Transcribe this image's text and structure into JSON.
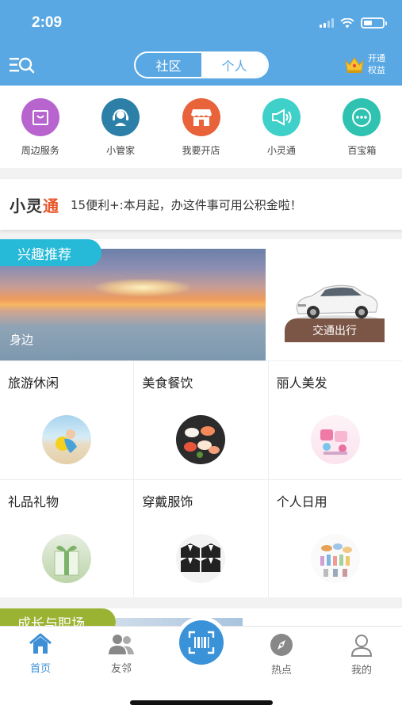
{
  "status_bar": {
    "time": "2:09"
  },
  "header": {
    "tabs": [
      {
        "label": "社区",
        "active": false
      },
      {
        "label": "个人",
        "active": true
      }
    ],
    "vip": {
      "line1": "开通",
      "line2": "权益"
    },
    "colors": {
      "primary": "#5aa8e3"
    }
  },
  "services": [
    {
      "label": "周边服务",
      "icon": "shopping-bag-icon",
      "color": "#b764cf"
    },
    {
      "label": "小管家",
      "icon": "headset-icon",
      "color": "#2c80a8"
    },
    {
      "label": "我要开店",
      "icon": "store-icon",
      "color": "#e8623a"
    },
    {
      "label": "小灵通",
      "icon": "megaphone-icon",
      "color": "#3fd0c9"
    },
    {
      "label": "百宝箱",
      "icon": "more-dots-icon",
      "color": "#2fc2b0"
    }
  ],
  "news": {
    "logo_a": "小灵",
    "logo_b": "通",
    "text": "15便利+:本月起，办这件事可用公积金啦！"
  },
  "interest": {
    "badge": "兴趣推荐",
    "banner_label": "身边",
    "traffic_label": "交通出行",
    "categories": [
      {
        "label": "旅游休闲",
        "icon": "beach-photo"
      },
      {
        "label": "美食餐饮",
        "icon": "sushi-photo"
      },
      {
        "label": "丽人美发",
        "icon": "beauty-photo"
      },
      {
        "label": "礼品礼物",
        "icon": "gift-photo"
      },
      {
        "label": "穿戴服饰",
        "icon": "suits-photo"
      },
      {
        "label": "个人日用",
        "icon": "daily-goods-photo"
      }
    ]
  },
  "growth": {
    "badge": "成长与职场"
  },
  "tabbar": {
    "items": [
      {
        "label": "首页",
        "icon": "home-icon",
        "active": true
      },
      {
        "label": "友邻",
        "icon": "neighbors-icon",
        "active": false
      },
      {
        "label": "热点",
        "icon": "compass-icon",
        "active": false
      },
      {
        "label": "我的",
        "icon": "profile-icon",
        "active": false
      }
    ],
    "scan_icon": "scan-icon",
    "active_color": "#3e8fd6"
  }
}
